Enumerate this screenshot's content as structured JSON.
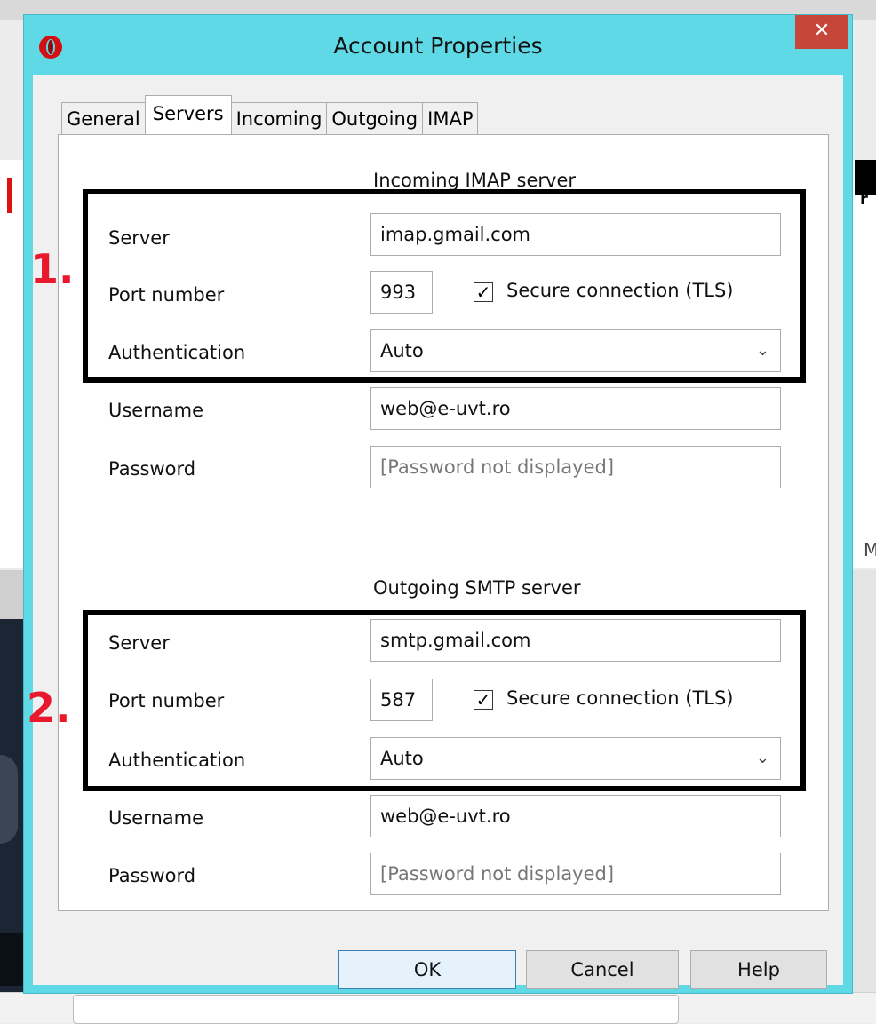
{
  "window": {
    "title": "Account Properties",
    "close_glyph": "✕"
  },
  "tabs": [
    {
      "label": "General",
      "active": false
    },
    {
      "label": "Servers",
      "active": true
    },
    {
      "label": "Incoming",
      "active": false
    },
    {
      "label": "Outgoing",
      "active": false
    },
    {
      "label": "IMAP",
      "active": false
    }
  ],
  "incoming": {
    "title": "Incoming IMAP server",
    "server_label": "Server",
    "server_value": "imap.gmail.com",
    "port_label": "Port number",
    "port_value": "993",
    "secure_label": "Secure connection (TLS)",
    "secure_checked": true,
    "auth_label": "Authentication",
    "auth_value": "Auto",
    "username_label": "Username",
    "username_value": "web@e-uvt.ro",
    "password_label": "Password",
    "password_placeholder": "[Password not displayed]"
  },
  "outgoing": {
    "title": "Outgoing SMTP server",
    "server_label": "Server",
    "server_value": "smtp.gmail.com",
    "port_label": "Port number",
    "port_value": "587",
    "secure_label": "Secure connection (TLS)",
    "secure_checked": true,
    "auth_label": "Authentication",
    "auth_value": "Auto",
    "username_label": "Username",
    "username_value": "web@e-uvt.ro",
    "password_label": "Password",
    "password_placeholder": "[Password not displayed]"
  },
  "annotations": {
    "first": "1.",
    "second": "2."
  },
  "buttons": {
    "ok": "OK",
    "cancel": "Cancel",
    "help": "Help"
  },
  "background": {
    "bottom_text": "...",
    "right_glyph": "r",
    "right_letter": "M"
  },
  "icons": {
    "app": "opera-icon",
    "select": "chevron-down-icon",
    "check": "checkmark-icon"
  },
  "colors": {
    "frame": "#5fd9e6",
    "close": "#c7463b",
    "annotation": "#e8192c"
  }
}
